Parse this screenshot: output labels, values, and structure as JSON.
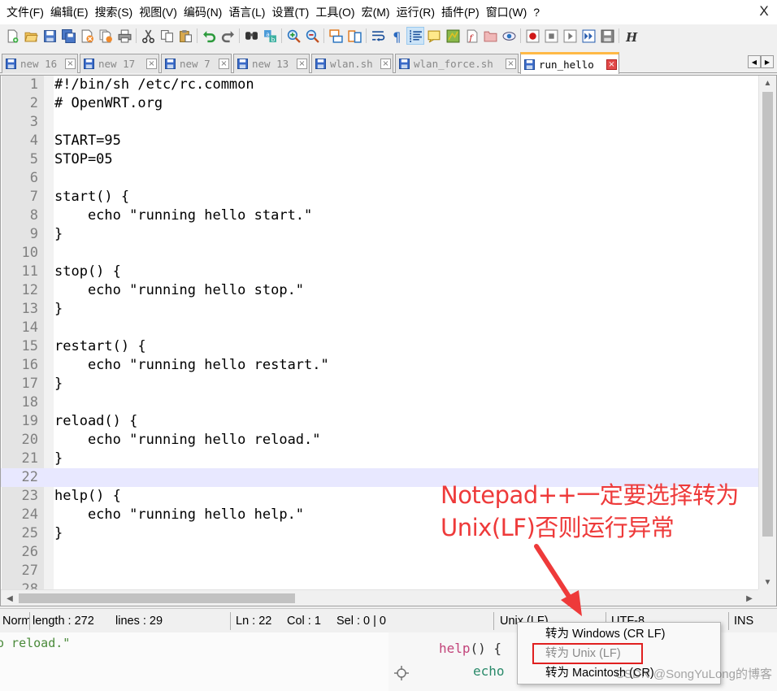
{
  "menubar": {
    "items": [
      "文件(F)",
      "编辑(E)",
      "搜索(S)",
      "视图(V)",
      "编码(N)",
      "语言(L)",
      "设置(T)",
      "工具(O)",
      "宏(M)",
      "运行(R)",
      "插件(P)",
      "窗口(W)",
      "?"
    ],
    "close_label": "X"
  },
  "toolbar": {
    "icons": [
      "new-file-icon",
      "open-file-icon",
      "save-icon",
      "save-all-icon",
      "close-icon",
      "close-all-icon",
      "print-icon",
      "cut-icon",
      "copy-icon",
      "paste-icon",
      "undo-icon",
      "redo-icon",
      "find-icon",
      "replace-icon",
      "zoom-in-icon",
      "zoom-out-icon",
      "sync-vertical-icon",
      "sync-horizontal-icon",
      "word-wrap-icon",
      "show-all-chars-icon",
      "indent-guide-icon",
      "udl-icon",
      "doc-map-icon",
      "function-list-icon",
      "folder-workspace-icon",
      "monitoring-icon",
      "record-macro-icon",
      "stop-record-icon",
      "play-macro-icon",
      "run-macro-multiple-icon",
      "save-macro-icon",
      "text-direction-icon"
    ]
  },
  "tabs": [
    {
      "label": "new 16",
      "active": false
    },
    {
      "label": "new 17",
      "active": false
    },
    {
      "label": "new 7",
      "active": false
    },
    {
      "label": "new 13",
      "active": false
    },
    {
      "label": "wlan.sh",
      "active": false
    },
    {
      "label": "wlan_force.sh",
      "active": false
    },
    {
      "label": "run_hello",
      "active": true
    }
  ],
  "tab_close_glyph": "×",
  "editor": {
    "current_line": 22,
    "lines": [
      {
        "n": "1",
        "text": "#!/bin/sh /etc/rc.common"
      },
      {
        "n": "2",
        "text": "# OpenWRT.org"
      },
      {
        "n": "3",
        "text": ""
      },
      {
        "n": "4",
        "text": "START=95"
      },
      {
        "n": "5",
        "text": "STOP=05"
      },
      {
        "n": "6",
        "text": ""
      },
      {
        "n": "7",
        "text": "start() {"
      },
      {
        "n": "8",
        "text": "    echo \"running hello start.\""
      },
      {
        "n": "9",
        "text": "}"
      },
      {
        "n": "10",
        "text": ""
      },
      {
        "n": "11",
        "text": "stop() {"
      },
      {
        "n": "12",
        "text": "    echo \"running hello stop.\""
      },
      {
        "n": "13",
        "text": "}"
      },
      {
        "n": "14",
        "text": ""
      },
      {
        "n": "15",
        "text": "restart() {"
      },
      {
        "n": "16",
        "text": "    echo \"running hello restart.\""
      },
      {
        "n": "17",
        "text": "}"
      },
      {
        "n": "18",
        "text": ""
      },
      {
        "n": "19",
        "text": "reload() {"
      },
      {
        "n": "20",
        "text": "    echo \"running hello reload.\""
      },
      {
        "n": "21",
        "text": "}"
      },
      {
        "n": "22",
        "text": ""
      },
      {
        "n": "23",
        "text": "help() {"
      },
      {
        "n": "24",
        "text": "    echo \"running hello help.\""
      },
      {
        "n": "25",
        "text": "}"
      },
      {
        "n": "26",
        "text": ""
      },
      {
        "n": "27",
        "text": ""
      },
      {
        "n": "28",
        "text": ""
      }
    ]
  },
  "statusbar": {
    "doc_type": "Norm",
    "length": "length : 272",
    "lines": "lines : 29",
    "ln": "Ln : 22",
    "col": "Col : 1",
    "sel": "Sel : 0 | 0",
    "eol": "Unix (LF)",
    "encoding": "UTF-8",
    "mode": "INS"
  },
  "context_menu": {
    "items": [
      {
        "label": "转为 Windows (CR LF)",
        "disabled": false
      },
      {
        "label": "转为 Unix (LF)",
        "disabled": true
      },
      {
        "label": "转为 Macintosh (CR)",
        "disabled": false
      }
    ]
  },
  "annotation": {
    "line1": "Notepad++一定要选择转为",
    "line2": "Unix(LF)否则运行异常",
    "color": "#ee3a3a"
  },
  "background_page": {
    "left_code": "o reload.\"",
    "right_line1_keyword": "help",
    "right_line1_rest": "() {",
    "right_line2": "echo"
  },
  "watermark": "CSDN @SongYuLong的博客"
}
